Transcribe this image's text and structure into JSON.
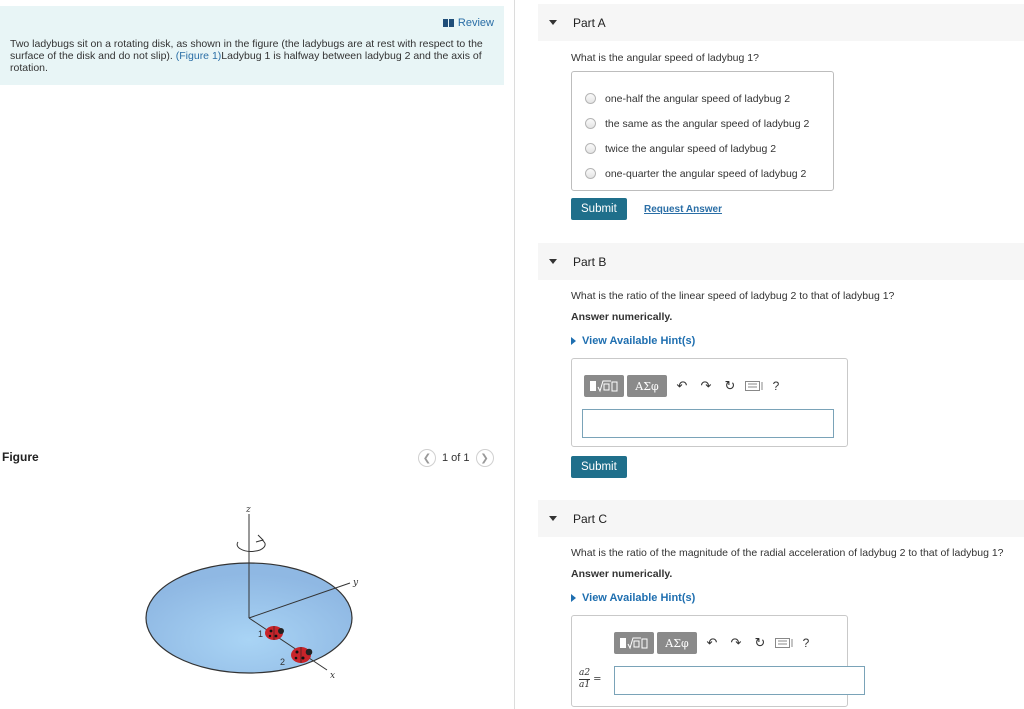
{
  "left": {
    "review_label": "Review",
    "intro_text": "Two ladybugs sit on a rotating disk, as shown in the figure (the ladybugs are at rest with respect to the surface of the disk and do not slip). ",
    "figure_link": "(Figure 1)",
    "intro_text_2": "Ladybug 1 is halfway between ladybug 2 and the axis of rotation.",
    "figure_label": "Figure",
    "pager_text": "1 of 1",
    "axis_z": "z",
    "axis_y": "y",
    "axis_x": "x",
    "bug1": "1",
    "bug2": "2"
  },
  "partA": {
    "title": "Part A",
    "question": "What is the angular speed of ladybug 1?",
    "choices": [
      "one-half the angular speed of ladybug 2",
      "the same as the angular speed of ladybug 2",
      "twice the angular speed of ladybug 2",
      "one-quarter the angular speed of ladybug 2"
    ],
    "submit": "Submit",
    "request": "Request Answer"
  },
  "partB": {
    "title": "Part B",
    "question": "What is the ratio of the linear speed of ladybug 2 to that of ladybug 1?",
    "instruction": "Answer numerically.",
    "hint": "View Available Hint(s)",
    "submit": "Submit"
  },
  "partC": {
    "title": "Part C",
    "question": "What is the ratio of the magnitude of the radial acceleration of ladybug 2 to that of ladybug 1?",
    "instruction": "Answer numerically.",
    "hint": "View Available Hint(s)",
    "frac_num": "a2",
    "frac_den": "a1",
    "equals": "="
  },
  "toolbar": {
    "greek": "ΑΣφ",
    "help": "?"
  }
}
